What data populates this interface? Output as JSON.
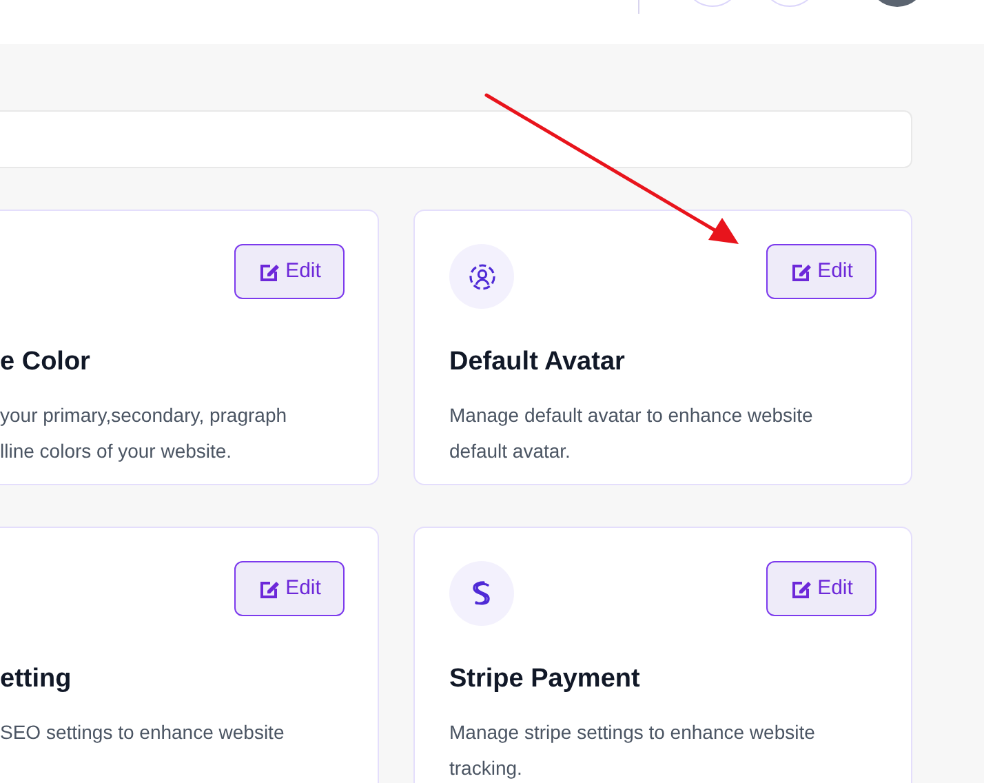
{
  "cards": [
    {
      "kind": "cut",
      "title": "e Color",
      "description_lines": [
        "your primary,secondary, pragraph",
        "lline colors of your website."
      ],
      "button": "Edit"
    },
    {
      "kind": "avatar",
      "title": "Default Avatar",
      "description_lines": [
        "Manage default avatar to enhance website",
        "default avatar."
      ],
      "button": "Edit"
    },
    {
      "kind": "cut",
      "title": "etting",
      "description_lines": [
        "SEO settings to enhance website"
      ],
      "button": "Edit"
    },
    {
      "kind": "stripe",
      "title": "Stripe Payment",
      "description_lines": [
        "Manage stripe settings to enhance website",
        "tracking."
      ],
      "button": "Edit"
    }
  ]
}
